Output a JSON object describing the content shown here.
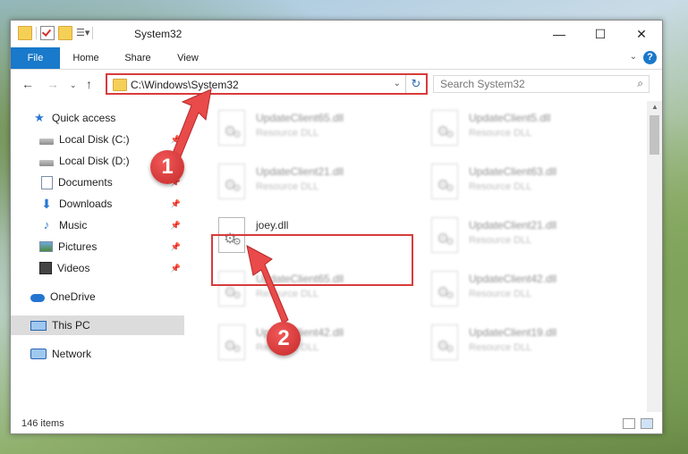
{
  "window": {
    "title": "System32"
  },
  "ribbon": {
    "tabs": [
      "File",
      "Home",
      "Share",
      "View"
    ],
    "help": "?"
  },
  "titlebar": {
    "minimize": "—",
    "maximize": "☐",
    "close": "✕"
  },
  "address": {
    "path": "C:\\Windows\\System32",
    "search_placeholder": "Search System32"
  },
  "sidebar": {
    "items": [
      {
        "label": "Quick access",
        "icon": "star-icon"
      },
      {
        "label": "Local Disk (C:)",
        "icon": "drive-icon"
      },
      {
        "label": "Local Disk (D:)",
        "icon": "drive-icon"
      },
      {
        "label": "Documents",
        "icon": "documents-icon"
      },
      {
        "label": "Downloads",
        "icon": "downloads-icon"
      },
      {
        "label": "Music",
        "icon": "music-icon"
      },
      {
        "label": "Pictures",
        "icon": "pictures-icon"
      },
      {
        "label": "Videos",
        "icon": "videos-icon"
      },
      {
        "label": "OneDrive",
        "icon": "onedrive-icon"
      },
      {
        "label": "This PC",
        "icon": "this-pc-icon"
      },
      {
        "label": "Network",
        "icon": "network-icon"
      }
    ]
  },
  "files": {
    "f0": {
      "name": "UpdateClient65.dll",
      "type": "Resource DLL"
    },
    "f1": {
      "name": "UpdateClient5.dll",
      "type": "Resource DLL"
    },
    "f2": {
      "name": "UpdateClient21.dll",
      "type": "Resource DLL"
    },
    "f3": {
      "name": "UpdateClient63.dll",
      "type": "Resource DLL"
    },
    "f4": {
      "name": "joey.dll",
      "type": ""
    },
    "f5": {
      "name": "UpdateClient21.dll",
      "type": "Resource DLL"
    },
    "f6": {
      "name": "UpdateClient65.dll",
      "type": "Resource DLL"
    },
    "f7": {
      "name": "UpdateClient42.dll",
      "type": "Resource DLL"
    },
    "f8": {
      "name": "UpdateClient42.dll",
      "type": "Resource DLL"
    },
    "f9": {
      "name": "UpdateClient19.dll",
      "type": "Resource DLL"
    }
  },
  "status": {
    "count": "146 items"
  },
  "callouts": {
    "one": "1",
    "two": "2"
  },
  "colors": {
    "accent": "#1979ca",
    "highlight": "#d83b3b"
  }
}
